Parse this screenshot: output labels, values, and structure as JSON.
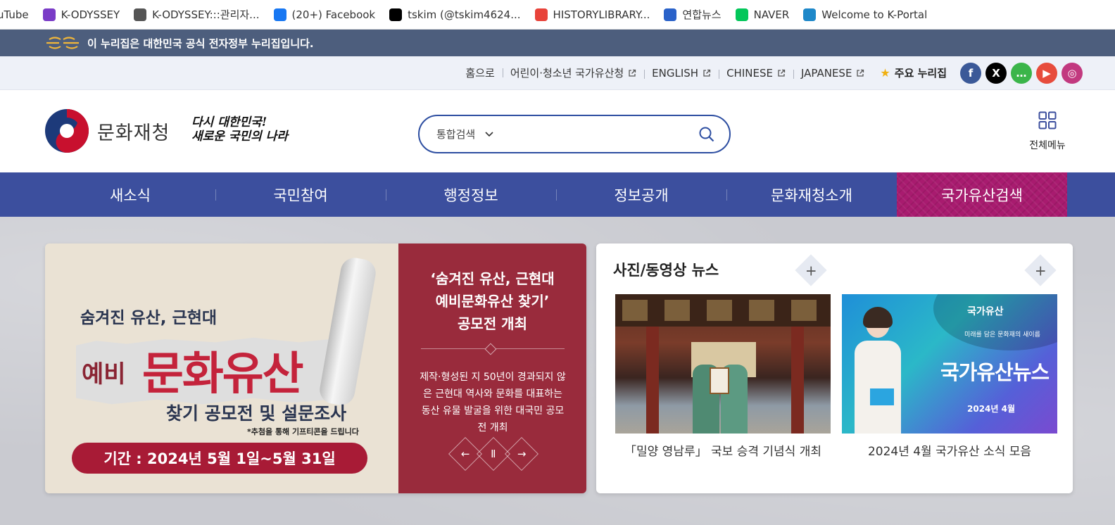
{
  "bookmarks": [
    {
      "label": "uTube",
      "icon": "youtube-icon",
      "color": "#ff0000"
    },
    {
      "label": "K-ODYSSEY",
      "icon": "k-odyssey-icon",
      "color": "#7a3cc7"
    },
    {
      "label": "K-ODYSSEY:::관리자...",
      "icon": "globe-icon",
      "color": "#555555"
    },
    {
      "label": "(20+) Facebook",
      "icon": "facebook-icon",
      "color": "#1877f2"
    },
    {
      "label": "tskim (@tskim4624...",
      "icon": "x-icon",
      "color": "#000000"
    },
    {
      "label": "HISTORYLIBRARY...",
      "icon": "historylibrary-icon",
      "color": "#e8433a"
    },
    {
      "label": "연합뉴스",
      "icon": "yonhap-icon",
      "color": "#2a62c9"
    },
    {
      "label": "NAVER",
      "icon": "naver-icon",
      "color": "#03c75a"
    },
    {
      "label": "Welcome to K-Portal",
      "icon": "k-portal-icon",
      "color": "#1e88c9"
    }
  ],
  "gov_banner": {
    "text": "이 누리집은 대한민국 공식 전자정부 누리집입니다."
  },
  "util_links": [
    {
      "label": "홈으로",
      "external": false
    },
    {
      "label": "어린이·청소년 국가유산청",
      "external": true
    },
    {
      "label": "ENGLISH",
      "external": true
    },
    {
      "label": "CHINESE",
      "external": true
    },
    {
      "label": "JAPANESE",
      "external": true
    }
  ],
  "main_sites": {
    "label": "주요 누리집"
  },
  "socials": [
    {
      "name": "facebook",
      "glyph": "f",
      "color": "#3b5998"
    },
    {
      "name": "x",
      "glyph": "X",
      "color": "#000000"
    },
    {
      "name": "kakao-story",
      "glyph": "…",
      "color": "#3bb54a"
    },
    {
      "name": "youtube",
      "glyph": "▶",
      "color": "#e74c3c"
    },
    {
      "name": "instagram",
      "glyph": "◎",
      "color": "#c2397f"
    }
  ],
  "header": {
    "logo_name": "문화재청",
    "slogan": [
      "다시 대한민국!",
      "새로운 국민의 나라"
    ],
    "search_select": "통합검색",
    "search_value": "",
    "all_menu": "전체메뉴"
  },
  "nav": [
    "새소식",
    "국민참여",
    "행정정보",
    "정보공개",
    "문화재청소개",
    "국가유산검색"
  ],
  "promo": {
    "img_line1": "숨겨진 유산, 근현대",
    "img_yebi": "예비",
    "img_big": "문화유산",
    "img_line2": "찾기 공모전 및 설문조사",
    "img_note": "*추첨을 통해 기프티콘을 드립니다",
    "img_period": "기간 : 2024년 5월 1일~5월 31일",
    "title": [
      "‘숨겨진 유산, 근현대",
      "예비문화유산 찾기’",
      "공모전 개최"
    ],
    "desc": "제작·형성된 지 50년이 경과되지 않은 근현대 역사와 문화를 대표하는 동산 유물 발굴을 위한 대국민 공모전 개최"
  },
  "news": {
    "title": "사진/동영상 뉴스",
    "items": [
      {
        "caption": "「밀양 영남루」 국보 승격 기념식 개최"
      },
      {
        "caption": "2024년 4월 국가유산 소식 모음",
        "thumb_label1": "국가유산",
        "thumb_label2": "미래를 담은 문화재의 새이름",
        "thumb_label3": "국가유산뉴스",
        "thumb_label4": "2024년 4월"
      }
    ]
  },
  "colors": {
    "gov_bar": "#4d5e7d",
    "nav": "#3c4f9e",
    "nav_special": "#a81b6f",
    "promo_red": "#992b3c"
  }
}
